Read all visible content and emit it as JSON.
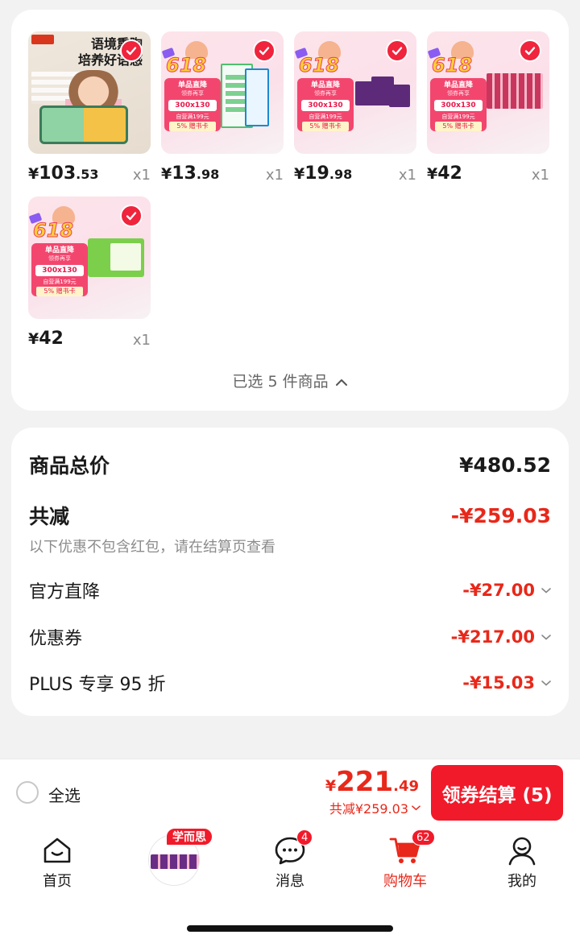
{
  "colors": {
    "accent": "#f11a2a",
    "discount_red": "#e8281a",
    "page_bg": "#f2f2f2"
  },
  "products": [
    {
      "price_currency": "¥",
      "price_int": "103",
      "price_dec": ".53",
      "qty": "x1",
      "art": "edu",
      "title_line1": "语境熏陶",
      "title_line2": "培养好语感",
      "selected": true
    },
    {
      "price_currency": "¥",
      "price_int": "13",
      "price_dec": ".98",
      "qty": "x1",
      "art": "promo-books",
      "selected": true
    },
    {
      "price_currency": "¥",
      "price_int": "19",
      "price_dec": ".98",
      "qty": "x1",
      "art": "promo-boxes",
      "selected": true
    },
    {
      "price_currency": "¥",
      "price_int": "42",
      "price_dec": "",
      "qty": "x1",
      "art": "promo-cards",
      "selected": true
    },
    {
      "price_currency": "¥",
      "price_int": "42",
      "price_dec": "",
      "qty": "x1",
      "art": "promo-green",
      "selected": true
    }
  ],
  "promo_badge": {
    "event": "618",
    "line1": "单品直降",
    "line2": "领券再享",
    "chip": "300x130",
    "line3": "自营满199元",
    "chip2": "5%  赠书卡"
  },
  "selection": {
    "summary": "已选 5 件商品",
    "icon": "chevron-up-icon"
  },
  "summary": {
    "total_label": "商品总价",
    "total_value": "¥480.52",
    "discount_label": "共减",
    "discount_value": "-¥259.03",
    "note": "以下优惠不包含红包，请在结算页查看",
    "items": [
      {
        "label": "官方直降",
        "value": "-¥27.00"
      },
      {
        "label": "优惠券",
        "value": "-¥217.00"
      },
      {
        "label": "PLUS 专享 95 折",
        "value": "-¥15.03"
      }
    ]
  },
  "checkout": {
    "select_all": "全选",
    "total_currency": "¥",
    "total_int": "221",
    "total_dec": ".49",
    "discount_text": "共减¥259.03",
    "button": "领券结算 (5)"
  },
  "tabs": [
    {
      "label": "首页",
      "icon": "home-icon"
    },
    {
      "label": "",
      "icon": "brand-avatar",
      "tag": "学而思"
    },
    {
      "label": "消息",
      "icon": "message-icon",
      "badge": "4"
    },
    {
      "label": "购物车",
      "icon": "cart-icon",
      "badge": "62",
      "active": true
    },
    {
      "label": "我的",
      "icon": "profile-icon"
    }
  ]
}
